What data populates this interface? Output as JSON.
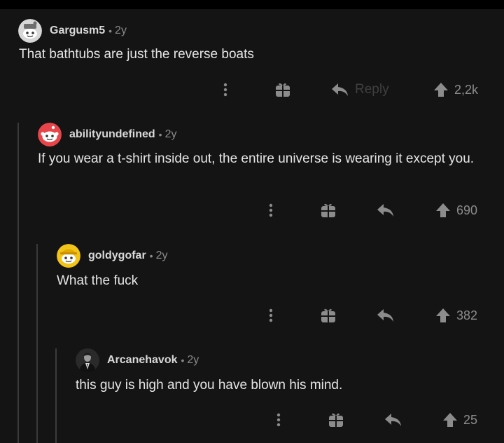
{
  "comments": [
    {
      "username": "Gargusm5",
      "separator": "•",
      "age": "2y",
      "text": "That bathtubs are just the reverse boats",
      "reply_label": "Reply",
      "votes": "2,2k",
      "avatar_icon": "snoo-avatar-gray"
    },
    {
      "username": "abilityundefined",
      "separator": "•",
      "age": "2y",
      "text": "If you wear a t-shirt inside out, the entire universe is wearing it except you.",
      "votes": "690",
      "avatar_icon": "snoo-avatar-red"
    },
    {
      "username": "goldygofar",
      "separator": "•",
      "age": "2y",
      "text": "What the fuck",
      "votes": "382",
      "avatar_icon": "snoo-avatar-yellow"
    },
    {
      "username": "Arcanehavok",
      "separator": "•",
      "age": "2y",
      "text": "this guy is high and you have blown his mind.",
      "votes": "25",
      "avatar_icon": "photo-avatar-man-in-suit"
    }
  ],
  "colors": {
    "background": "#141414",
    "text": "#e6e6e6",
    "muted": "#8c8c8c",
    "thread_line": "#3a3a3a"
  }
}
